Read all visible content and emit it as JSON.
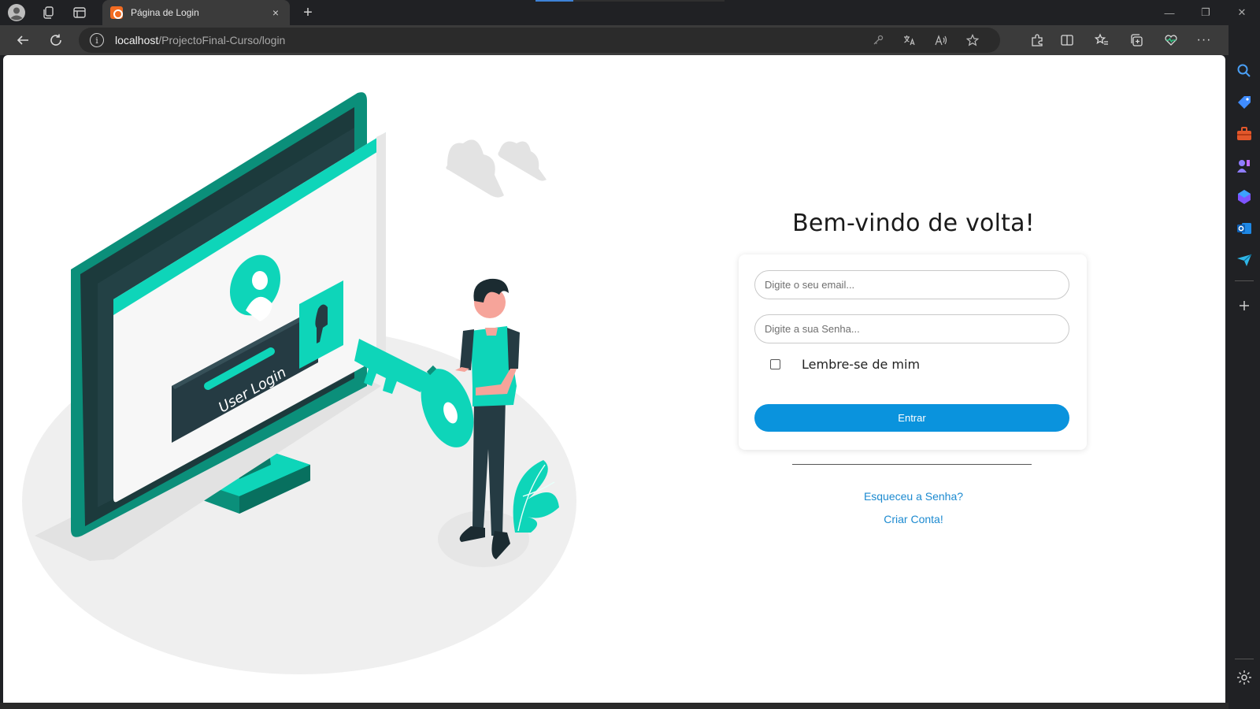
{
  "browser": {
    "tab": {
      "title": "Página de Login",
      "close_glyph": "×"
    },
    "new_tab_glyph": "+",
    "window_controls": {
      "minimize": "—",
      "restore": "❐",
      "close": "✕"
    },
    "address": {
      "host": "localhost",
      "path": "/ProjectoFinal-Curso/login"
    },
    "toolbar_icons": [
      "back-icon",
      "refresh-icon",
      "site-info-icon",
      "key-icon",
      "translate-icon",
      "read-aloud-icon",
      "favorite-star-icon",
      "extensions-icon",
      "split-screen-icon",
      "favorites-icon",
      "collections-icon",
      "performance-icon",
      "more-icon",
      "copilot-icon"
    ],
    "sidebar_icons": [
      "search-icon",
      "shopping-icon",
      "tools-icon",
      "games-icon",
      "office-icon",
      "outlook-icon",
      "send-icon",
      "add-icon",
      "settings-icon"
    ]
  },
  "illustration": {
    "screen_label": "User Login"
  },
  "login": {
    "heading": "Bem-vindo de volta!",
    "email_placeholder": "Digite o seu email...",
    "password_placeholder": "Digite a sua Senha...",
    "remember_label": "Lembre-se de mim",
    "submit_label": "Entrar",
    "forgot_link": "Esqueceu a Senha?",
    "create_link": "Criar Conta!"
  },
  "colors": {
    "accent": "#0a93dd",
    "link": "#1c8ad0",
    "illustration_teal": "#0ed5b9",
    "illustration_dark_teal": "#0b8f7a",
    "illustration_navy": "#253b43"
  }
}
